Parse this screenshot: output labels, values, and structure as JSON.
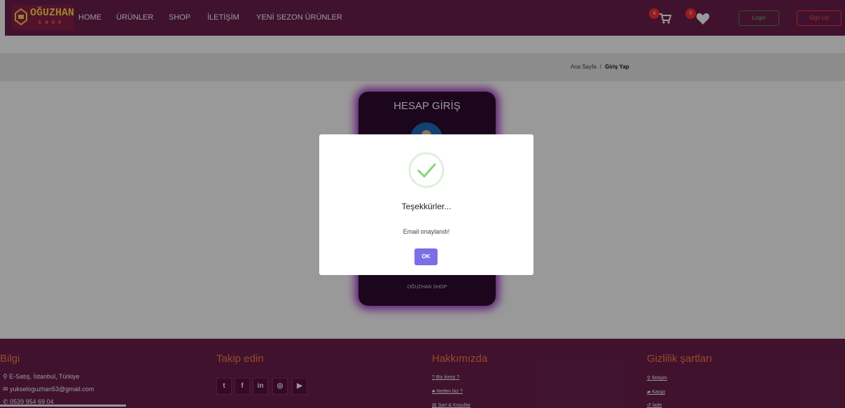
{
  "brand": {
    "name": "OĞUZHAN",
    "tagline": "SHOP"
  },
  "nav": {
    "items": [
      {
        "label": "HOME"
      },
      {
        "label": "ÜRÜNLER"
      },
      {
        "label": "SHOP"
      },
      {
        "label": "İLETİŞİM"
      },
      {
        "label": "YENİ SEZON ÜRÜNLER"
      }
    ],
    "cart_count": "4",
    "favorites_count": "0",
    "login_label": "Login",
    "signup_label": "Sign Up"
  },
  "breadcrumb": {
    "home": "Ana Sayfa",
    "separator": "/",
    "current": "Giriş Yap"
  },
  "login_card": {
    "title": "HESAP GİRİŞ",
    "footer": "OĞUZHAN SHOP"
  },
  "modal": {
    "title": "Teşekkürler...",
    "message": "Email onaylandı!",
    "ok_label": "OK"
  },
  "footer": {
    "info": {
      "heading": "Bilgi",
      "address": "E-Satış, İstanbul, Türkiye",
      "email": "yukseloguzhan53@gmail.com",
      "phone": "0539 954 69 04"
    },
    "follow": {
      "heading": "Takip edin",
      "icons": [
        "twitter-icon",
        "facebook-icon",
        "linkedin-icon",
        "instagram-icon",
        "youtube-icon"
      ]
    },
    "about": {
      "heading": "Hakkımızda",
      "links": [
        "Biz kimiz ?",
        "Neden biz ?",
        "Şart & Koşullar"
      ]
    },
    "privacy": {
      "heading": "Gizlilik şartları",
      "links": [
        "İletişim",
        "Kargo",
        "İade"
      ]
    }
  },
  "colors": {
    "navbar": "#6b1f4d",
    "footer_heading": "#ff7a45",
    "ok_button": "#7b6fe6",
    "success_check": "#8bd17c"
  }
}
